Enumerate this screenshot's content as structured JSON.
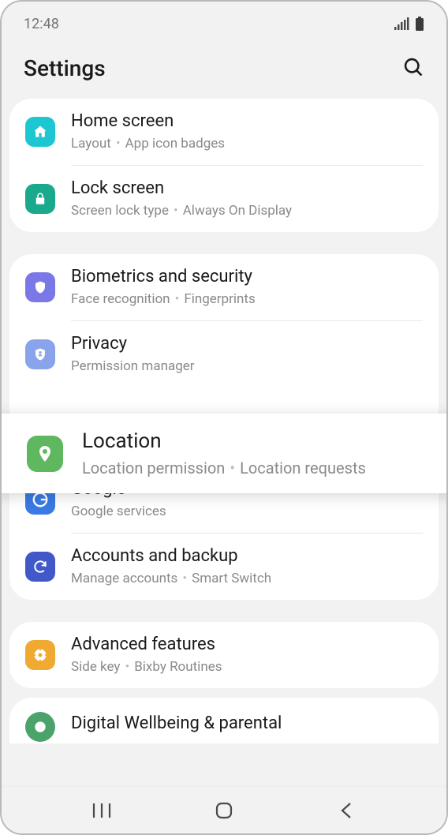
{
  "statusBar": {
    "time": "12:48"
  },
  "header": {
    "title": "Settings"
  },
  "groups": [
    {
      "items": [
        {
          "id": "home-screen",
          "title": "Home screen",
          "sub": [
            "Layout",
            "App icon badges"
          ],
          "iconBg": "#1dc7d1",
          "icon": "home"
        },
        {
          "id": "lock-screen",
          "title": "Lock screen",
          "sub": [
            "Screen lock type",
            "Always On Display"
          ],
          "iconBg": "#1aa98c",
          "icon": "lock"
        }
      ]
    },
    {
      "items": [
        {
          "id": "biometrics",
          "title": "Biometrics and security",
          "sub": [
            "Face recognition",
            "Fingerprints"
          ],
          "iconBg": "#7a78e6",
          "icon": "shield"
        },
        {
          "id": "privacy",
          "title": "Privacy",
          "sub": [
            "Permission manager"
          ],
          "iconBg": "#8aa4ec",
          "icon": "privacy"
        },
        {
          "id": "location",
          "title": "Location",
          "sub": [
            "Location permission",
            "Location requests"
          ],
          "iconBg": "#5fb85f",
          "icon": "pin",
          "highlighted": true
        },
        {
          "id": "google",
          "title": "Google",
          "sub": [
            "Google services"
          ],
          "iconBg": "#3a7ae4",
          "icon": "google"
        },
        {
          "id": "accounts",
          "title": "Accounts and backup",
          "sub": [
            "Manage accounts",
            "Smart Switch"
          ],
          "iconBg": "#4158c9",
          "icon": "sync"
        }
      ]
    },
    {
      "items": [
        {
          "id": "advanced",
          "title": "Advanced features",
          "sub": [
            "Side key",
            "Bixby Routines"
          ],
          "iconBg": "#f0a931",
          "icon": "gear"
        }
      ]
    },
    {
      "partial": true,
      "items": [
        {
          "id": "wellbeing",
          "title": "Digital Wellbeing & parental",
          "sub": [],
          "iconBg": "#4ba36b",
          "icon": "wellbeing"
        }
      ]
    }
  ]
}
